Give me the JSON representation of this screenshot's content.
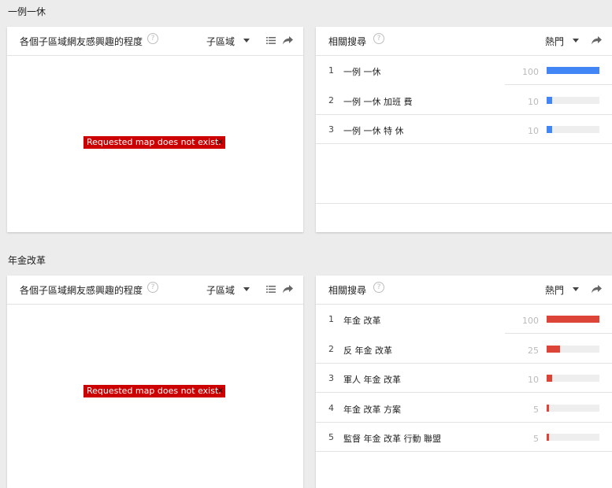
{
  "colors": {
    "blue_bar": "#4285f4",
    "red_bar": "#db4437",
    "map_error_bg": "#cc0000"
  },
  "sections": [
    {
      "title": "一例一休",
      "map_card": {
        "title": "各個子區域網友感興趣的程度",
        "dropdown": "子區域",
        "error_text": "Requested map does not exist.",
        "error_close": "×"
      },
      "related_card": {
        "title": "相關搜尋",
        "dropdown": "熱門",
        "bar_color": "blue",
        "rows": [
          {
            "rank": "1",
            "term": "一例 一休",
            "value": 100
          },
          {
            "rank": "2",
            "term": "一例 一休 加班 費",
            "value": 10
          },
          {
            "rank": "3",
            "term": "一例 一休 特 休",
            "value": 10
          }
        ]
      }
    },
    {
      "title": "年金改革",
      "map_card": {
        "title": "各個子區域網友感興趣的程度",
        "dropdown": "子區域",
        "error_text": "Requested map does not exist.",
        "error_close": "×"
      },
      "related_card": {
        "title": "相關搜尋",
        "dropdown": "熱門",
        "bar_color": "red",
        "rows": [
          {
            "rank": "1",
            "term": "年金 改革",
            "value": 100
          },
          {
            "rank": "2",
            "term": "反 年金 改革",
            "value": 25
          },
          {
            "rank": "3",
            "term": "軍人 年金 改革",
            "value": 10
          },
          {
            "rank": "4",
            "term": "年金 改革 方案",
            "value": 5
          },
          {
            "rank": "5",
            "term": "監督 年金 改革 行動 聯盟",
            "value": 5
          }
        ]
      }
    }
  ]
}
